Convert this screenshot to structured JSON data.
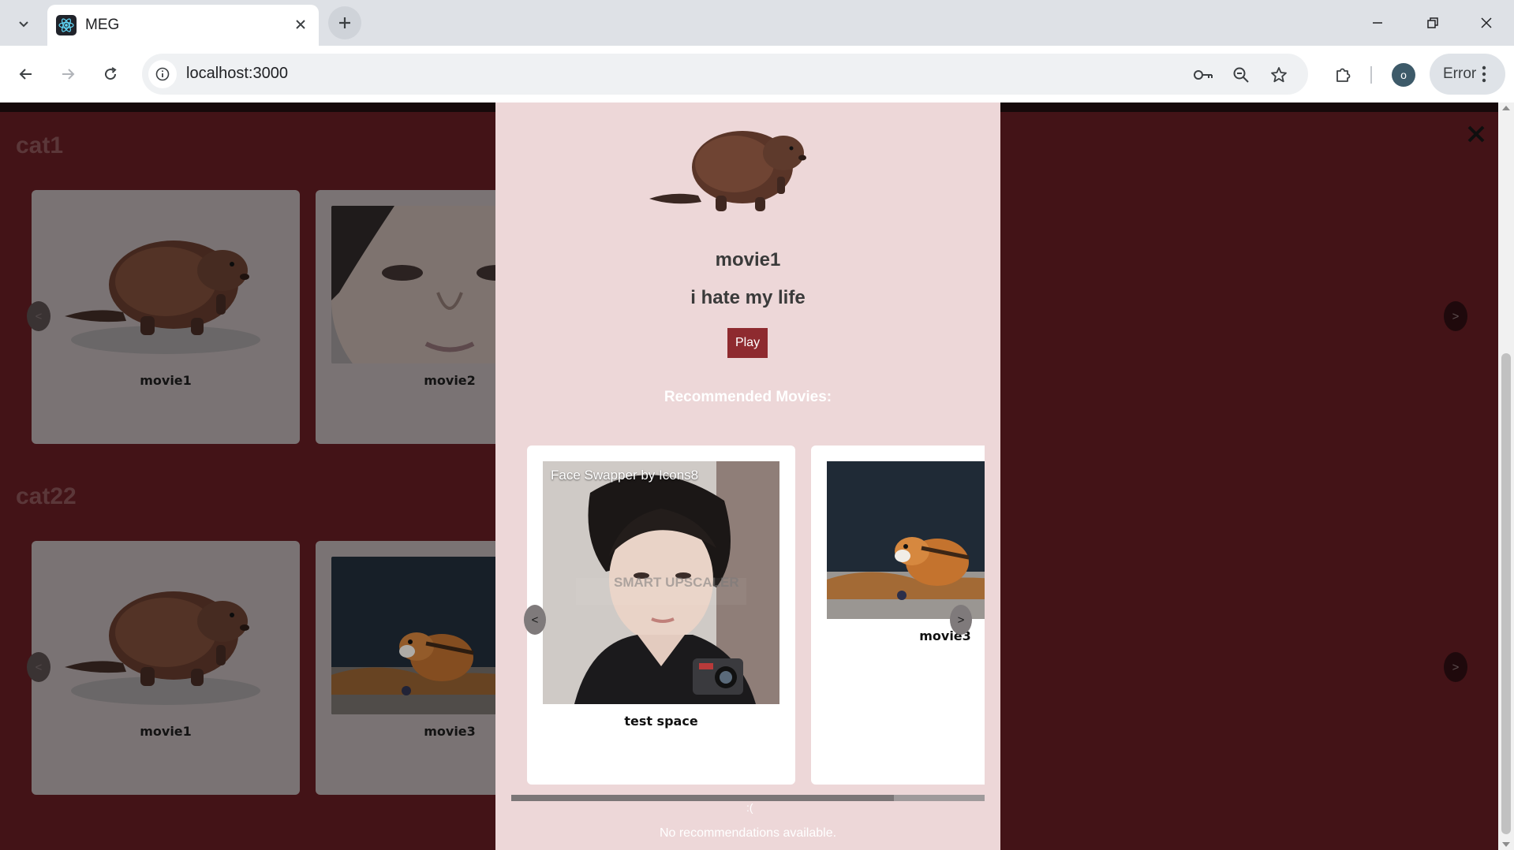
{
  "browser": {
    "tab_title": "MEG",
    "url": "localhost:3000",
    "profile_initial": "o",
    "error_label": "Error"
  },
  "categories": [
    {
      "title": "cat1",
      "cards": [
        {
          "label": "movie1",
          "image": "beaver"
        },
        {
          "label": "movie2",
          "image": "face-closeup"
        }
      ],
      "prev": "<",
      "next": ">"
    },
    {
      "title": "cat22",
      "cards": [
        {
          "label": "movie1",
          "image": "beaver"
        },
        {
          "label": "movie3",
          "image": "chipmunk"
        }
      ],
      "prev": "<",
      "next": ">"
    }
  ],
  "modal": {
    "title": "movie1",
    "description": "i hate my life",
    "play_label": "Play",
    "recommended_heading": "Recommended Movies:",
    "recommendations": [
      {
        "label": "test space",
        "image": "portrait-camera",
        "image_caption": "Face Swapper by Icons8",
        "watermark": "SMART UPSCALER"
      },
      {
        "label": "movie3",
        "image": "chipmunk"
      }
    ],
    "prev": "<",
    "next": ">",
    "frown": ":(",
    "empty_message": "No recommendations available."
  }
}
